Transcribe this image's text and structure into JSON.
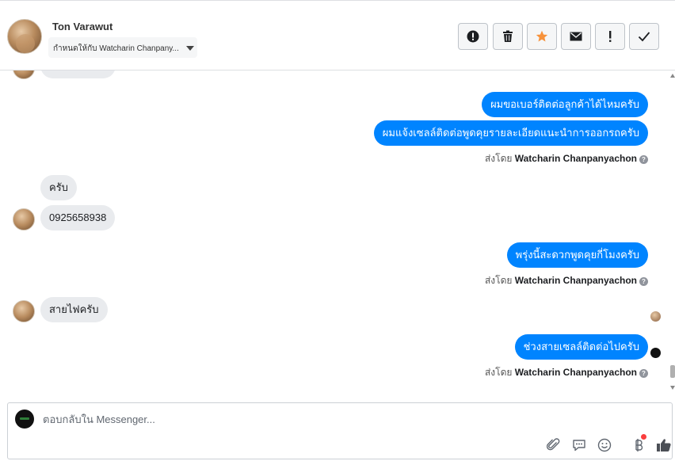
{
  "header": {
    "contact_name": "Ton Varawut",
    "assign_label": "กำหนดให้กับ Watcharin Chanpany...",
    "toolbar": [
      {
        "icon": "alert-circle-icon"
      },
      {
        "icon": "trash-icon"
      },
      {
        "icon": "star-icon",
        "color": "#f7923b"
      },
      {
        "icon": "envelope-icon"
      },
      {
        "icon": "exclamation-icon"
      },
      {
        "icon": "checkmark-icon"
      }
    ]
  },
  "messages": {
    "out_1": "ผมขอเบอร์ติดต่อลูกค้าได้ไหมครับ",
    "out_2": "ผมแจ้งเซลล์ติดต่อพูดคุยรายละเอียดแนะนำการออกรถครับ",
    "sent_by_prefix": "ส่งโดย",
    "sent_by_name": "Watcharin Chanpanyachon",
    "in_1": "ครับ",
    "in_2": "0925658938",
    "out_3": "พรุ่งนี้สะดวกพูดคุยกี่โมงครับ",
    "in_3": "สายไฟครับ",
    "out_4": "ช่วงสายเซลล์ติดต่อไปครับ",
    "help_glyph": "?"
  },
  "composer": {
    "placeholder": "ตอบกลับใน Messenger...",
    "icons": [
      "paperclip-icon",
      "comment-icon",
      "smiley-icon",
      "baht-icon",
      "thumbs-up-icon"
    ]
  },
  "colors": {
    "outgoing_bubble": "#0084ff",
    "incoming_bubble": "#e9ebee",
    "star": "#f7923b"
  }
}
